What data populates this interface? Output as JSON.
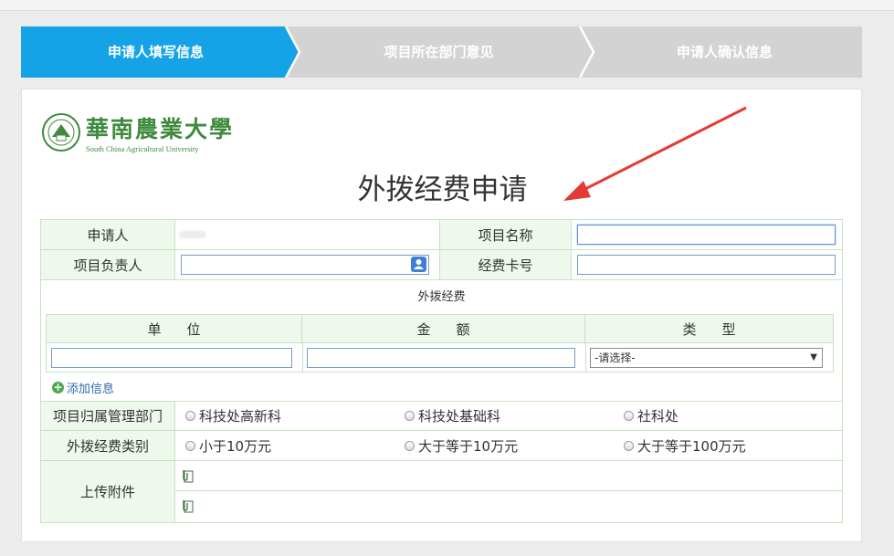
{
  "steps": [
    {
      "label": "申请人填写信息",
      "active": true
    },
    {
      "label": "项目所在部门意见",
      "active": false
    },
    {
      "label": "申请人确认信息",
      "active": false
    }
  ],
  "colors": {
    "step_active": "#14a3e6",
    "step_inactive": "#d3d3d3",
    "label_bg": "#eef8ec",
    "border": "#c6e3c1",
    "logo_green": "#3f8a3f",
    "arrow": "#e53935"
  },
  "logo": {
    "cn": "華南農業大學",
    "en": "South China Agricultural University"
  },
  "title": "外拨经费申请",
  "form": {
    "applicant_label": "申请人",
    "project_name_label": "项目名称",
    "project_lead_label": "项目负责人",
    "card_no_label": "经费卡号",
    "section_label": "外拨经费",
    "sub_headers": [
      "单位",
      "金额",
      "类型"
    ],
    "type_select_value": "-请选择-",
    "add_link": "添加信息",
    "dept_label": "项目归属管理部门",
    "dept_options": [
      "科技处高新科",
      "科技处基础科",
      "社科处"
    ],
    "category_label": "外拨经费类别",
    "category_options": [
      "小于10万元",
      "大于等于10万元",
      "大于等于100万元"
    ],
    "upload_label": "上传附件"
  },
  "icons": {
    "picker": "user-picker-icon",
    "add": "add-circle-icon",
    "clip": "paperclip-icon"
  }
}
